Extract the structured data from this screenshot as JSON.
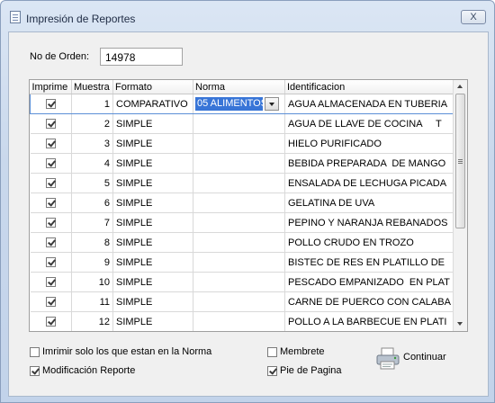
{
  "window": {
    "title": "Impresión de Reportes",
    "close_glyph": "X"
  },
  "order": {
    "label": "No de Orden:",
    "value": "14978"
  },
  "grid": {
    "headers": {
      "imprime": "Imprime",
      "muestra": "Muestra",
      "formato": "Formato",
      "norma": "Norma",
      "identificacion": "Identificacion"
    },
    "rows": [
      {
        "imprime": true,
        "muestra": "1",
        "formato": "COMPARATIVO",
        "norma": "05 ALIMENTOS",
        "identificacion": "AGUA ALMACENADA EN TUBERIA"
      },
      {
        "imprime": true,
        "muestra": "2",
        "formato": "SIMPLE",
        "norma": "",
        "identificacion": "AGUA DE LLAVE DE COCINA     T"
      },
      {
        "imprime": true,
        "muestra": "3",
        "formato": "SIMPLE",
        "norma": "",
        "identificacion": "HIELO PURIFICADO"
      },
      {
        "imprime": true,
        "muestra": "4",
        "formato": "SIMPLE",
        "norma": "",
        "identificacion": "BEBIDA PREPARADA  DE MANGO"
      },
      {
        "imprime": true,
        "muestra": "5",
        "formato": "SIMPLE",
        "norma": "",
        "identificacion": "ENSALADA DE LECHUGA PICADA"
      },
      {
        "imprime": true,
        "muestra": "6",
        "formato": "SIMPLE",
        "norma": "",
        "identificacion": "GELATINA DE UVA"
      },
      {
        "imprime": true,
        "muestra": "7",
        "formato": "SIMPLE",
        "norma": "",
        "identificacion": "PEPINO Y NARANJA REBANADOS"
      },
      {
        "imprime": true,
        "muestra": "8",
        "formato": "SIMPLE",
        "norma": "",
        "identificacion": "POLLO CRUDO EN TROZO"
      },
      {
        "imprime": true,
        "muestra": "9",
        "formato": "SIMPLE",
        "norma": "",
        "identificacion": "BISTEC DE RES EN PLATILLO DE"
      },
      {
        "imprime": true,
        "muestra": "10",
        "formato": "SIMPLE",
        "norma": "",
        "identificacion": "PESCADO EMPANIZADO  EN PLAT"
      },
      {
        "imprime": true,
        "muestra": "11",
        "formato": "SIMPLE",
        "norma": "",
        "identificacion": "CARNE DE PUERCO CON CALABA"
      },
      {
        "imprime": true,
        "muestra": "12",
        "formato": "SIMPLE",
        "norma": "",
        "identificacion": "POLLO A LA BARBECUE EN PLATI"
      }
    ]
  },
  "options": {
    "solo_norma": {
      "label": "Imrimir solo los que estan en la Norma",
      "checked": false
    },
    "membrete": {
      "label": "Membrete",
      "checked": false
    },
    "modificacion": {
      "label": "Modificación Reporte",
      "checked": true
    },
    "pie_pagina": {
      "label": "Pie de Pagina",
      "checked": true
    }
  },
  "actions": {
    "continuar": "Continuar",
    "continuar_icon": "printer-icon"
  },
  "colors": {
    "selection": "#3875d7",
    "window_frame": "#c9d8ec"
  }
}
